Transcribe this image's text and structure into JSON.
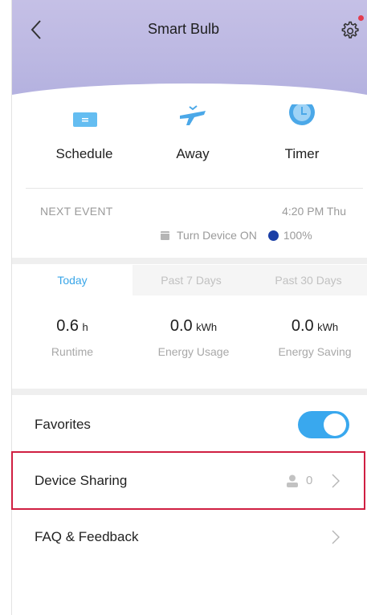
{
  "header": {
    "title": "Smart Bulb",
    "back_icon": "chevron-left-icon",
    "settings_icon": "gear-icon",
    "notification_dot_color": "#e33b4e",
    "gradient_color": "#bcb8e2"
  },
  "quick_actions": [
    {
      "label": "Schedule",
      "icon": "schedule-icon"
    },
    {
      "label": "Away",
      "icon": "away-icon"
    },
    {
      "label": "Timer",
      "icon": "timer-icon"
    }
  ],
  "next_event": {
    "label": "NEXT EVENT",
    "time": "4:20 PM  Thu",
    "action": "Turn Device ON",
    "brightness": "100%",
    "dot_color": "#1b3fa6"
  },
  "tabs": [
    {
      "label": "Today",
      "active": true
    },
    {
      "label": "Past 7 Days",
      "active": false
    },
    {
      "label": "Past 30 Days",
      "active": false
    }
  ],
  "stats": [
    {
      "value": "0.6",
      "unit": "h",
      "label": "Runtime"
    },
    {
      "value": "0.0",
      "unit": "kWh",
      "label": "Energy Usage"
    },
    {
      "value": "0.0",
      "unit": "kWh",
      "label": "Energy Saving"
    }
  ],
  "rows": {
    "favorites": {
      "label": "Favorites",
      "toggle_on": true
    },
    "device_sharing": {
      "label": "Device Sharing",
      "count": "0"
    },
    "faq": {
      "label": "FAQ & Feedback"
    }
  },
  "colors": {
    "accent": "#3aa6e8",
    "toggle": "#39a8ee",
    "highlight_border": "#d01f42"
  }
}
